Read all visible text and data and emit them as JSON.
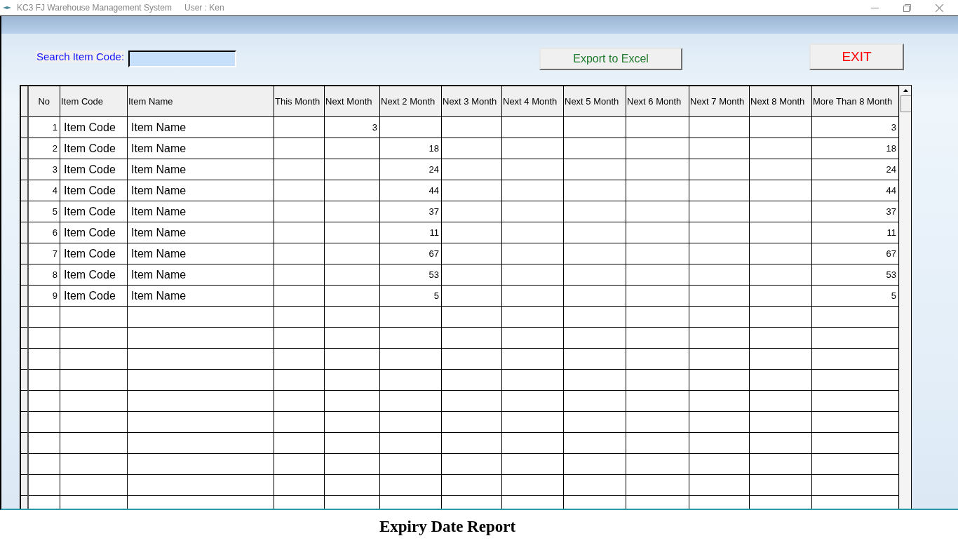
{
  "window": {
    "title": "KC3 FJ Warehouse Management System",
    "user": "User : Ken"
  },
  "search": {
    "label": "Search Item Code:"
  },
  "buttons": {
    "export": "Export to Excel",
    "exit": "EXIT"
  },
  "table": {
    "columns": [
      "No",
      "Item Code",
      "Item Name",
      "This Month",
      "Next Month",
      "Next 2 Month",
      "Next 3 Month",
      "Next 4 Month",
      "Next 5 Month",
      "Next 6 Month",
      "Next 7 Month",
      "Next 8 Month",
      "More Than 8 Month"
    ],
    "rows": [
      {
        "no": "1",
        "item_code": "Item Code",
        "item_name": "Item Name",
        "next_month": "3",
        "more_than_8_month": "3"
      },
      {
        "no": "2",
        "item_code": "Item Code",
        "item_name": "Item Name",
        "next_2_month": "18",
        "more_than_8_month": "18"
      },
      {
        "no": "3",
        "item_code": "Item Code",
        "item_name": "Item Name",
        "next_2_month": "24",
        "more_than_8_month": "24"
      },
      {
        "no": "4",
        "item_code": "Item Code",
        "item_name": "Item Name",
        "next_2_month": "44",
        "more_than_8_month": "44"
      },
      {
        "no": "5",
        "item_code": "Item Code",
        "item_name": "Item Name",
        "next_2_month": "37",
        "more_than_8_month": "37"
      },
      {
        "no": "6",
        "item_code": "Item Code",
        "item_name": "Item Name",
        "next_2_month": "11",
        "more_than_8_month": "11"
      },
      {
        "no": "7",
        "item_code": "Item Code",
        "item_name": "Item Name",
        "next_2_month": "67",
        "more_than_8_month": "67"
      },
      {
        "no": "8",
        "item_code": "Item Code",
        "item_name": "Item Name",
        "next_2_month": "53",
        "more_than_8_month": "53"
      },
      {
        "no": "9",
        "item_code": "Item Code",
        "item_name": "Item Name",
        "next_2_month": "5",
        "more_than_8_month": "5"
      }
    ]
  },
  "footer": {
    "title": "Expiry Date Report"
  }
}
